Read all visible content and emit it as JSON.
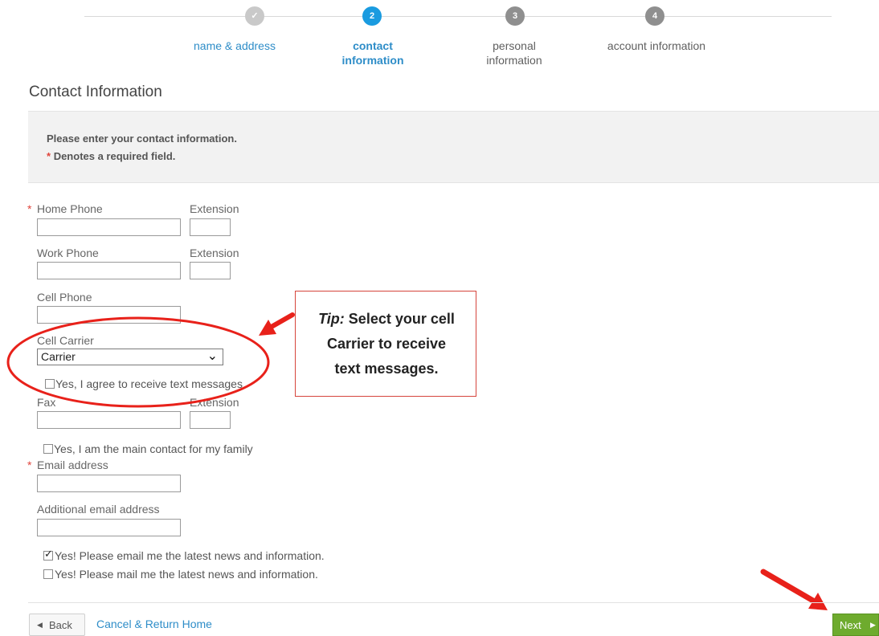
{
  "stepper": {
    "steps": [
      {
        "num": "✓",
        "label": "name & address",
        "state": "done"
      },
      {
        "num": "2",
        "label_lines": [
          "contact",
          "information"
        ],
        "state": "active"
      },
      {
        "num": "3",
        "label_lines": [
          "personal",
          "information"
        ],
        "state": "pending"
      },
      {
        "num": "4",
        "label": "account information",
        "state": "pending"
      }
    ]
  },
  "section_title": "Contact Information",
  "info": {
    "line1": "Please enter your contact information.",
    "required_mark": "*",
    "line2": "Denotes a required field."
  },
  "fields": {
    "home_phone": "Home Phone",
    "home_ext": "Extension",
    "work_phone": "Work Phone",
    "work_ext": "Extension",
    "cell_phone": "Cell Phone",
    "cell_carrier": "Cell Carrier",
    "carrier_selected": "Carrier",
    "text_agree": "Yes, I agree to receive text messages",
    "fax": "Fax",
    "fax_ext": "Extension",
    "main_contact": "Yes, I am the main contact for my family",
    "email": "Email address",
    "additional_email": "Additional email address",
    "news_email": "Yes! Please email me the latest news and information.",
    "news_email_checked": true,
    "news_mail": "Yes! Please mail me the latest news and information."
  },
  "tip": {
    "prefix": "Tip:",
    "line1_rest": " Select your cell",
    "line2": "Carrier to receive",
    "line3": "text messages."
  },
  "footer": {
    "back": "Back",
    "cancel": "Cancel & Return Home",
    "next": "Next"
  },
  "colors": {
    "accent": "#1a9be0",
    "required": "#e0443b",
    "annotation": "#e8211a",
    "next_button": "#6eab2e"
  }
}
